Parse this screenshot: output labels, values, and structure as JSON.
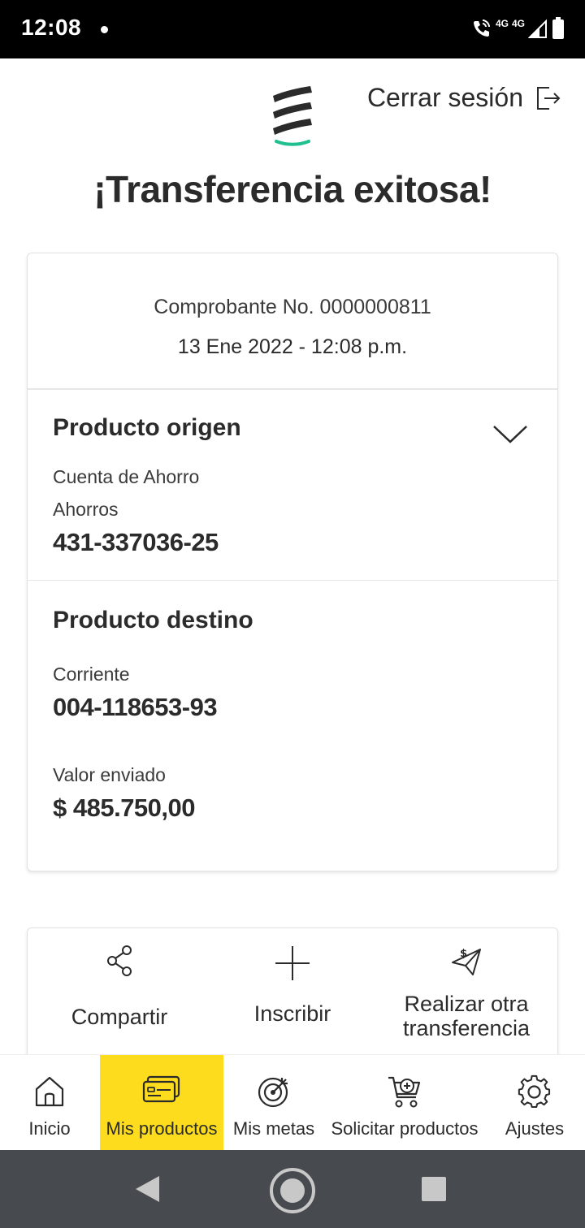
{
  "status_bar": {
    "time": "12:08",
    "network_a": "4G",
    "network_b": "4G"
  },
  "header": {
    "logout_label": "Cerrar sesión"
  },
  "page": {
    "title": "¡Transferencia exitosa!"
  },
  "receipt": {
    "number_text": "Comprobante No. 0000000811",
    "date_text": "13 Ene 2022 - 12:08 p.m.",
    "origin": {
      "title": "Producto origen",
      "product_name": "Cuenta de Ahorro",
      "account_type": "Ahorros",
      "account_number": "431-337036-25"
    },
    "destination": {
      "title": "Producto destino",
      "account_type": "Corriente",
      "account_number": "004-118653-93"
    },
    "amount_label": "Valor enviado",
    "amount_value": "$ 485.750,00"
  },
  "actions": [
    {
      "label": "Compartir",
      "icon": "share-icon"
    },
    {
      "label": "Inscribir",
      "icon": "plus-icon"
    },
    {
      "label_line1": "Realizar otra",
      "label_line2": "transferencia",
      "icon": "send-money-icon"
    }
  ],
  "bottom_nav": {
    "items": [
      {
        "label": "Inicio",
        "icon": "home-icon",
        "active": false
      },
      {
        "label": "Mis productos",
        "icon": "cards-icon",
        "active": true
      },
      {
        "label": "Mis metas",
        "icon": "target-icon",
        "active": false
      },
      {
        "label": "Solicitar productos",
        "icon": "cart-add-icon",
        "active": false
      },
      {
        "label": "Ajustes",
        "icon": "gear-icon",
        "active": false
      }
    ]
  },
  "colors": {
    "accent_yellow": "#fcdc1c",
    "logo_green": "#1fbf8f",
    "text_dark": "#2b2b2b",
    "system_nav": "#474b50"
  }
}
